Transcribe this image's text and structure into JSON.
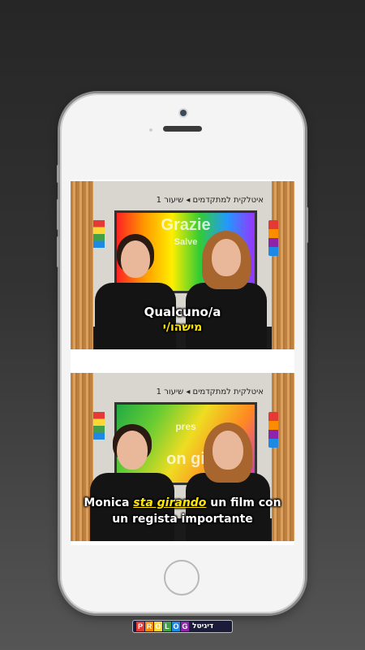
{
  "video1": {
    "header": "איטלקית למתקדמים ◂ שיעור 1",
    "screen_title": "Grazie",
    "screen_sub": "Salve",
    "caption_it": "Qualcuno/a",
    "caption_he": "מישהו/י"
  },
  "video2": {
    "header": "איטלקית למתקדמים ◂ שיעור 1",
    "screen_title": "pres",
    "screen_sub": "on gi",
    "caption_pre": "Monica ",
    "caption_highlight": "sta girando",
    "caption_post": " un film con",
    "caption_line2": "un regista importante"
  },
  "brand": {
    "letters": [
      "P",
      "R",
      "O",
      "L",
      "O",
      "G"
    ],
    "letter_colors": [
      "#e53935",
      "#fb8c00",
      "#fdd835",
      "#43a047",
      "#1e88e5",
      "#8e24aa"
    ],
    "hebrew": "דיגיטל"
  },
  "icons": [
    "camera-icon",
    "home-button-icon"
  ]
}
